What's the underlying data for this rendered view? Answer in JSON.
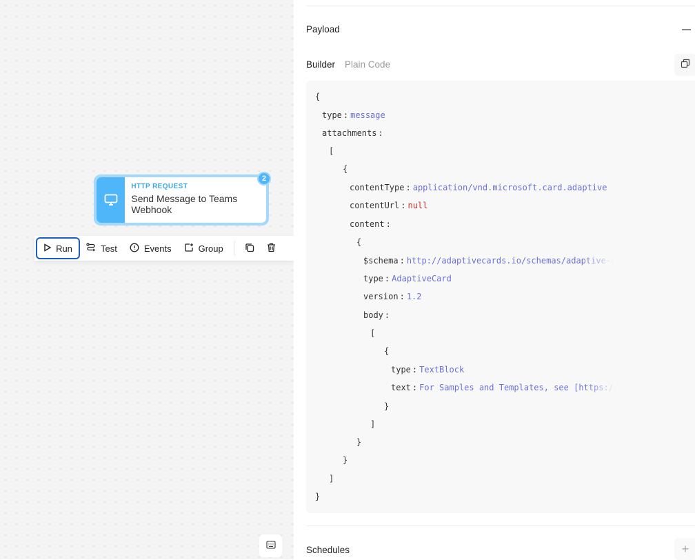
{
  "node": {
    "kind": "HTTP REQUEST",
    "name": "Send Message to Teams Webhook",
    "badge": "2"
  },
  "toolbar": {
    "run": "Run",
    "test": "Test",
    "events": "Events",
    "group": "Group"
  },
  "panel": {
    "payload_title": "Payload",
    "tabs": [
      "Builder",
      "Plain Code"
    ],
    "active_tab": "Builder",
    "schedules_title": "Schedules"
  },
  "code": {
    "open": "{",
    "close": "}",
    "lb": "[",
    "rb": "]",
    "type_key": "type",
    "type_val": "message",
    "attachments_key": "attachments",
    "contentType_key": "contentType",
    "contentType_val": "application/vnd.microsoft.card.adaptive",
    "contentUrl_key": "contentUrl",
    "contentUrl_val": "null",
    "content_key": "content",
    "schema_key": "$schema",
    "schema_val": "http://adaptivecards.io/schemas/adaptive-c",
    "ctype_val": "AdaptiveCard",
    "version_key": "version",
    "version_val": "1.2",
    "body_key": "body",
    "tb_type_val": "TextBlock",
    "text_key": "text",
    "text_val": "For Samples and Templates, see [https://",
    "colon": ":"
  },
  "colors": {
    "accent": "#4fb6f9",
    "value": "#6a6fd8",
    "null": "#d0312d",
    "run_border": "#1a5fbf"
  }
}
